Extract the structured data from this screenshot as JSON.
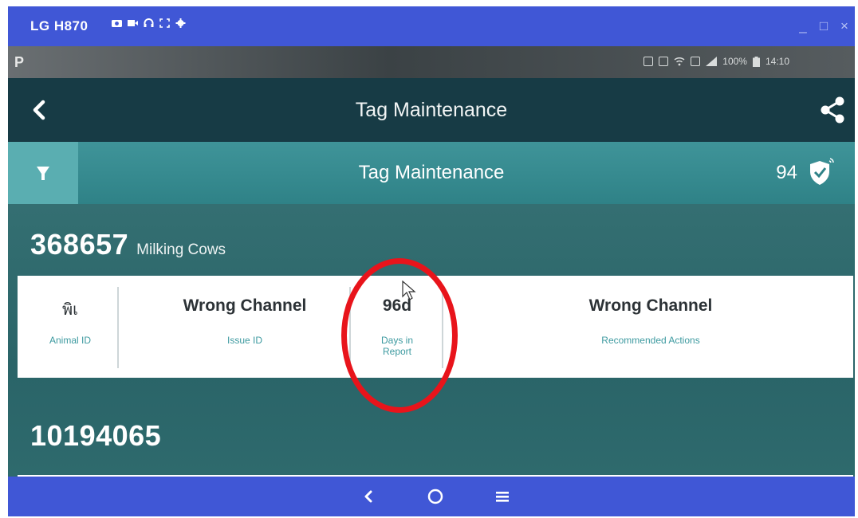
{
  "window": {
    "title": "LG H870",
    "toolbar_icons": [
      "camera-icon",
      "video-icon",
      "headset-icon",
      "fullscreen-icon",
      "settings-icon"
    ],
    "controls": {
      "minimize": "_",
      "maximize": "□",
      "close": "×"
    }
  },
  "status_bar": {
    "left_glyph": "P",
    "battery": "100%",
    "time": "14:10"
  },
  "header": {
    "title": "Tag Maintenance"
  },
  "section": {
    "title": "Tag Maintenance",
    "count": "94"
  },
  "groups": [
    {
      "count": "368657",
      "label": "Milking Cows",
      "record": {
        "animal_id": "พิเ",
        "animal_id_caption": "Animal ID",
        "issue": "Wrong Channel",
        "issue_caption": "Issue ID",
        "days": "96d",
        "days_caption_1": "Days in",
        "days_caption_2": "Report",
        "action": "Wrong Channel",
        "action_caption": "Recommended Actions"
      }
    },
    {
      "count": "10194065"
    }
  ],
  "colors": {
    "window_bar": "#4057d6",
    "app_header": "#173b45",
    "section_bar": "#3f9499",
    "content_bg": "#2f6a6d",
    "caption_teal": "#3d9aa0",
    "annotation_red": "#e8141b"
  }
}
